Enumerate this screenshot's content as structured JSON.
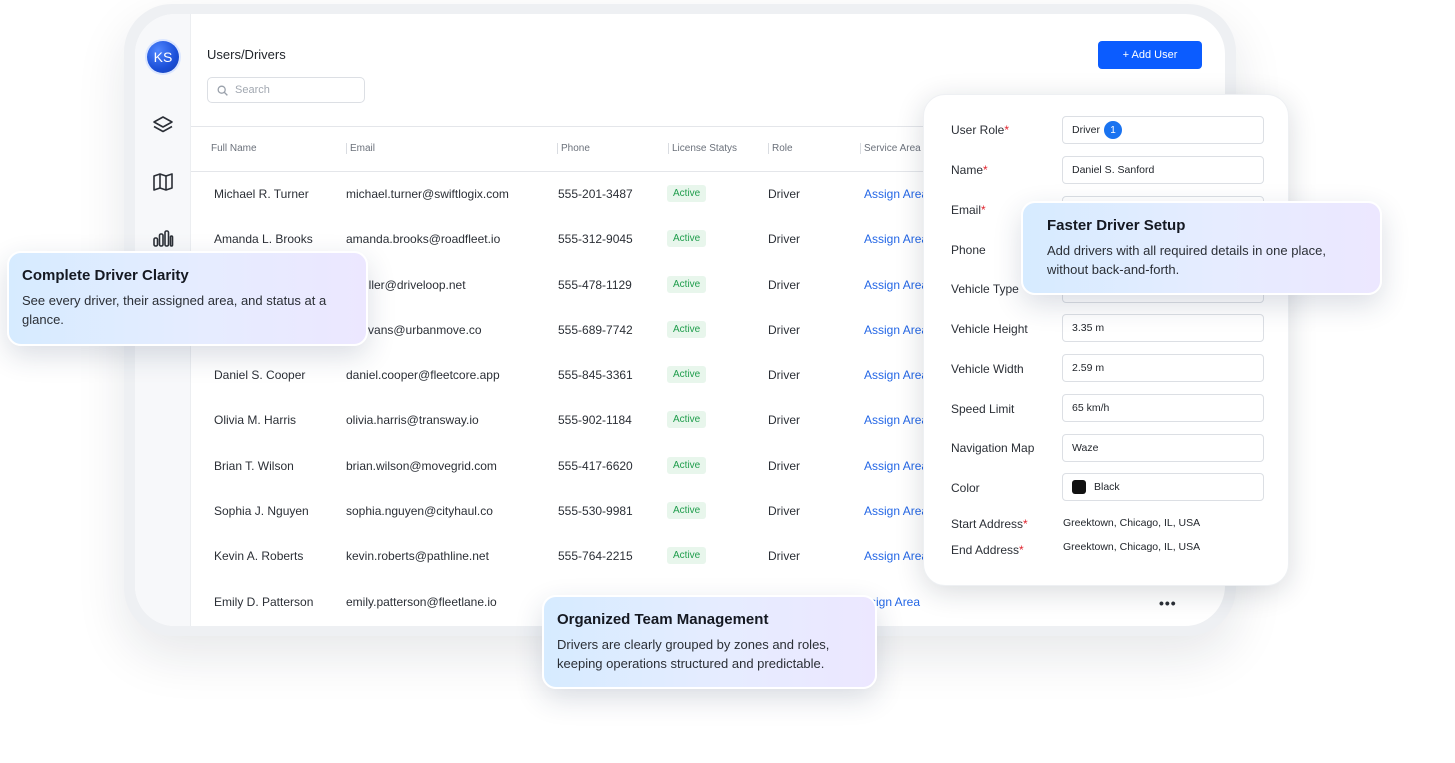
{
  "app": {
    "title": "Users/Drivers",
    "avatar_initials": "KS",
    "add_user_label": "+ Add User",
    "search_placeholder": "Search"
  },
  "nav_icons": [
    "layers-icon",
    "map-icon",
    "bar-chart-icon"
  ],
  "table": {
    "columns": [
      "Full Name",
      "Email",
      "Phone",
      "License Statys",
      "Role",
      "Service Area"
    ],
    "rows": [
      {
        "name": "Michael R. Turner",
        "email": "michael.turner@swiftlogix.com",
        "phone": "555-201-3487",
        "status": "Active",
        "role": "Driver",
        "area": "Assign Area"
      },
      {
        "name": "Amanda L. Brooks",
        "email": "amanda.brooks@roadfleet.io",
        "phone": "555-312-9045",
        "status": "Active",
        "role": "Driver",
        "area": "Assign Area"
      },
      {
        "name": "",
        "email": "n.miller@driveloop.net",
        "phone": "555-478-1129",
        "status": "Active",
        "role": "Driver",
        "area": "Assign Area"
      },
      {
        "name": "",
        "email": "iel.evans@urbanmove.co",
        "phone": "555-689-7742",
        "status": "Active",
        "role": "Driver",
        "area": "Assign Area"
      },
      {
        "name": "Daniel S. Cooper",
        "email": "daniel.cooper@fleetcore.app",
        "phone": "555-845-3361",
        "status": "Active",
        "role": "Driver",
        "area": "Assign Area"
      },
      {
        "name": "Olivia M. Harris",
        "email": "olivia.harris@transway.io",
        "phone": "555-902-1184",
        "status": "Active",
        "role": "Driver",
        "area": "Assign Area"
      },
      {
        "name": "Brian T. Wilson",
        "email": "brian.wilson@movegrid.com",
        "phone": "555-417-6620",
        "status": "Active",
        "role": "Driver",
        "area": "Assign Area"
      },
      {
        "name": "Sophia J. Nguyen",
        "email": "sophia.nguyen@cityhaul.co",
        "phone": "555-530-9981",
        "status": "Active",
        "role": "Driver",
        "area": "Assign Area"
      },
      {
        "name": "Kevin A. Roberts",
        "email": "kevin.roberts@pathline.net",
        "phone": "555-764-2215",
        "status": "Active",
        "role": "Driver",
        "area": "Assign Area"
      },
      {
        "name": "Emily D. Patterson",
        "email": "emily.patterson@fleetlane.io",
        "phone": "",
        "status": "",
        "role": "",
        "area": "ssign Area"
      }
    ],
    "row_menu": "•••"
  },
  "form": {
    "user_role_label": "User Role",
    "user_role_value": "Driver",
    "user_role_count": "1",
    "name_label": "Name",
    "name_value": "Daniel S. Sanford",
    "email_label": "Email",
    "phone_label": "Phone",
    "vehicle_type_label": "Vehicle Type",
    "vehicle_height_label": "Vehicle Height",
    "vehicle_height_value": "3.35 m",
    "vehicle_width_label": "Vehicle Width",
    "vehicle_width_value": "2.59 m",
    "speed_limit_label": "Speed Limit",
    "speed_limit_value": "65 km/h",
    "navigation_map_label": "Navigation Map",
    "navigation_map_value": "Waze",
    "color_label": "Color",
    "color_value": "Black",
    "color_swatch": "#111111",
    "start_address_label": "Start Address",
    "start_address_value": "Greektown, Chicago, IL, USA",
    "end_address_label": "End Address",
    "end_address_value": "Greektown, Chicago, IL, USA",
    "required_mark": "*"
  },
  "callouts": {
    "clarity": {
      "title": "Complete Driver Clarity",
      "text": "See every driver, their assigned area, and status at a glance."
    },
    "setup": {
      "title": "Faster Driver Setup",
      "text": "Add drivers with all required details in one place, without back-and-forth."
    },
    "team": {
      "title": "Organized Team Management",
      "text": "Drivers are clearly grouped by zones and roles, keeping operations structured and predictable."
    }
  },
  "colors": {
    "primary": "#0b5cff",
    "active_text": "#1f9d4c",
    "active_bg": "#e8f6ec",
    "link": "#2467e6",
    "required": "#e0242e"
  }
}
